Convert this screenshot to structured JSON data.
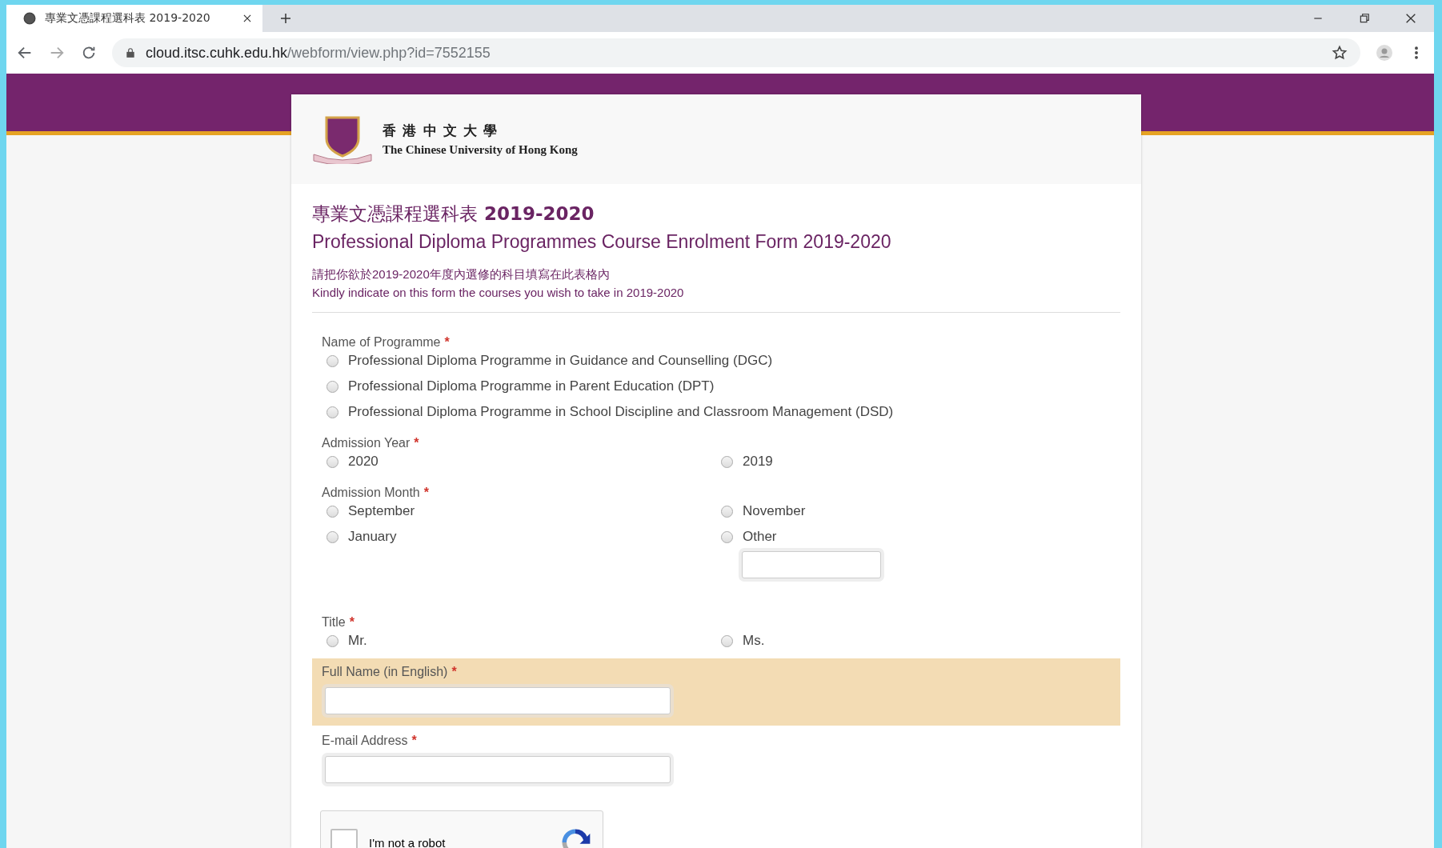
{
  "browser": {
    "tab_title": "專業文憑課程選科表 2019-2020",
    "url_host": "cloud.itsc.cuhk.edu.hk",
    "url_path": "/webform/view.php?id=7552155"
  },
  "header": {
    "university_zh": "香 港 中 文 大 學",
    "university_en": "The Chinese University of Hong Kong"
  },
  "form": {
    "title_zh": "專業文憑課程選科表",
    "title_year": "2019-2020",
    "title_en": "Professional Diploma Programmes Course Enrolment Form 2019-2020",
    "intro_zh": "請把你欲於2019-2020年度內選修的科目填寫在此表格內",
    "intro_en": "Kindly indicate on this form the courses you wish to take in 2019-2020"
  },
  "fields": [
    {
      "kind": "radio_list",
      "label": "Name of Programme",
      "required_mark": "*",
      "options": [
        {
          "label": "Professional Diploma Programme in Guidance and Counselling (DGC)",
          "selected": false,
          "kind": "plain"
        },
        {
          "label": "Professional Diploma Programme in Parent Education (DPT)",
          "selected": false,
          "kind": "plain"
        },
        {
          "label": "Professional Diploma Programme in School Discipline and Classroom Management (DSD)",
          "selected": false,
          "kind": "plain"
        }
      ]
    },
    {
      "kind": "radio_grid",
      "label": "Admission Year",
      "required_mark": "*",
      "options": [
        {
          "label": "2020",
          "selected": false,
          "kind": "plain"
        },
        {
          "label": "2019",
          "selected": false,
          "kind": "plain"
        }
      ]
    },
    {
      "kind": "radio_grid",
      "label": "Admission Month",
      "required_mark": "*",
      "options": [
        {
          "label": "September",
          "selected": false,
          "kind": "plain"
        },
        {
          "label": "November",
          "selected": false,
          "kind": "plain"
        },
        {
          "label": "January",
          "selected": false,
          "kind": "plain"
        },
        {
          "label": "Other",
          "selected": false,
          "kind": "with_input"
        }
      ]
    },
    {
      "kind": "radio_grid",
      "label": "Title",
      "required_mark": "*",
      "options": [
        {
          "label": "Mr.",
          "selected": false,
          "kind": "plain"
        },
        {
          "label": "Ms.",
          "selected": false,
          "kind": "plain"
        }
      ]
    },
    {
      "kind": "text",
      "label": "Full Name (in English)",
      "required_mark": "*",
      "focused": true
    },
    {
      "kind": "text",
      "label": "E-mail Address",
      "required_mark": "*",
      "focused": false
    }
  ],
  "captcha": {
    "label": "I'm not a robot",
    "checked": false
  }
}
